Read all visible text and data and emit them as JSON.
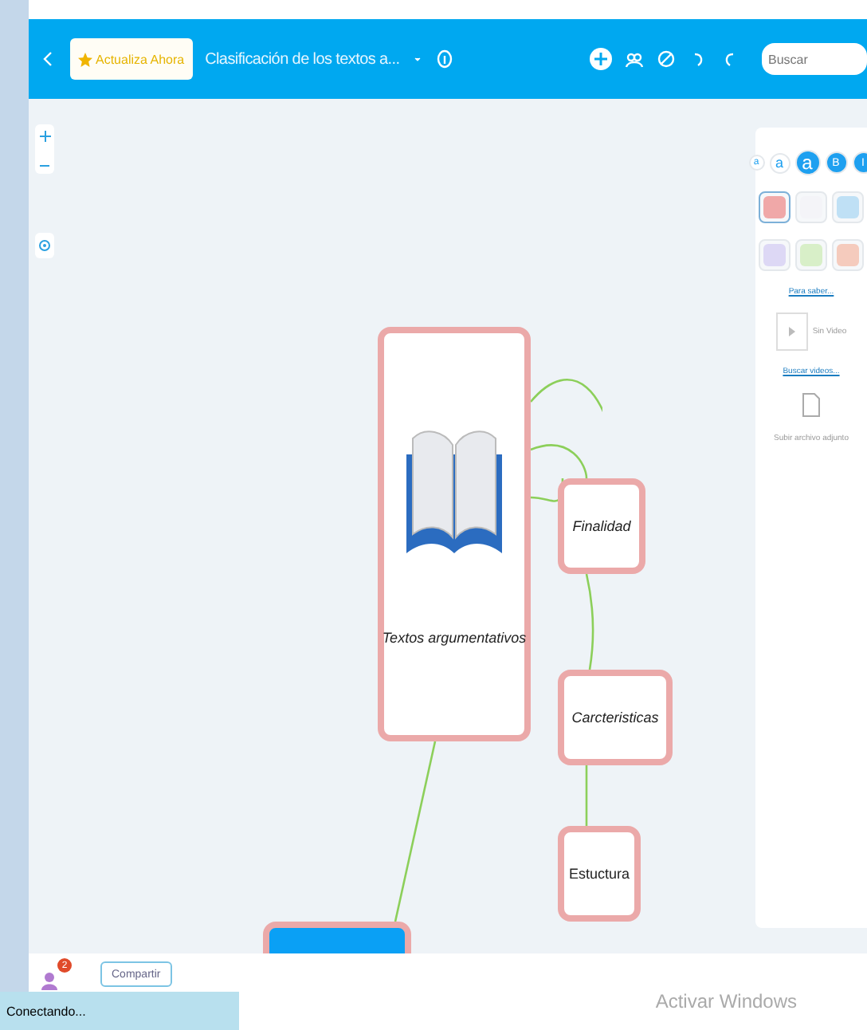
{
  "toolbar": {
    "upgrade": "Actualiza Ahora",
    "title": "Clasificación de los textos a...",
    "search": {
      "placeholder": "Buscar"
    }
  },
  "map": {
    "nodes": [
      {
        "kind": "image",
        "label": "Textos argumentativos",
        "italic": true
      },
      {
        "kind": "topic",
        "label": "Finalidad",
        "italic": true
      },
      {
        "kind": "topic",
        "label": "Carcteristicas",
        "italic": true
      },
      {
        "kind": "topic",
        "label": "Estuctura",
        "italic": false
      },
      {
        "kind": "blue"
      }
    ]
  },
  "panel": {
    "font_sizes": [
      {
        "label": "a",
        "selected": false
      },
      {
        "label": "a",
        "selected": false
      },
      {
        "label": "a",
        "selected": true
      }
    ],
    "styles": [
      {
        "label": "B",
        "selected": true
      },
      {
        "label": "I",
        "selected": true
      }
    ],
    "shapes": [
      {
        "color": "#f0a8a8",
        "selected": true
      },
      {
        "color": "#f4f4f8",
        "selected": false
      },
      {
        "color": "#bfe0f5",
        "selected": false
      },
      {
        "color": "#ddd8f5",
        "selected": false
      },
      {
        "color": "#d8efc8",
        "selected": false
      },
      {
        "color": "#f5cbbd",
        "selected": false
      }
    ],
    "more_link": "Para saber...",
    "video_label": "Sin Video",
    "video_link": "Buscar videos...",
    "attach_label": "Subir archivo adjunto"
  },
  "bottom": {
    "badge": "2",
    "share": "Compartir",
    "status": "Conectando...",
    "watermark": "Activar Windows"
  }
}
